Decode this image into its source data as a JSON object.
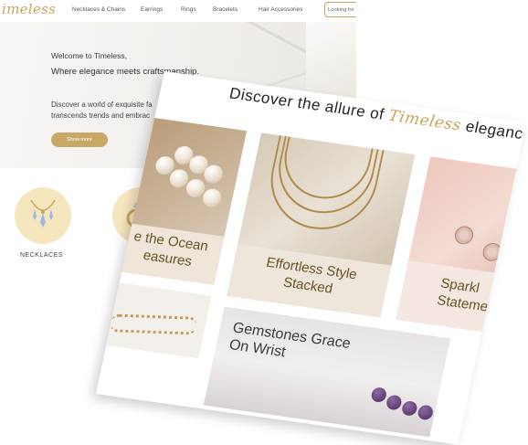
{
  "site": {
    "logo": "Timeless",
    "logo_visible": "imeless",
    "nav": [
      "Necklaces & Chains",
      "Earrings",
      "Rings",
      "Bracelets",
      "Hair Accessories"
    ],
    "search_placeholder": "Looking for"
  },
  "hero": {
    "welcome": "Welcome to Timeless,",
    "tagline": "Where elegance meets craftsmanship.",
    "description": [
      "Discover a world of exquisite fa",
      "transcends trends and embrac"
    ],
    "button_label": "Show more"
  },
  "categories": [
    {
      "label": "NECKLACES",
      "icon": "necklace-icon"
    },
    {
      "label": "",
      "icon": "ring-icon"
    }
  ],
  "feature": {
    "title_before": "Discover the allure of",
    "title_brand": "Timeless",
    "title_after": "elegance",
    "cards": [
      {
        "label": "e the Ocean\neasures",
        "icon": "pearl-necklace-photo"
      },
      {
        "label": "Effortless Style\nStacked",
        "icon": "layered-chain-photo"
      },
      {
        "label": "Sparkl\nStateme",
        "icon": "rose-earrings-photo"
      },
      {
        "label": "",
        "icon": "gold-bracelet-photo"
      },
      {
        "label": "Gemstones Grace\nOn Wrist",
        "icon": "amethyst-bracelet-photo"
      }
    ]
  },
  "colors": {
    "accent": "#c8a45c",
    "button": "#c9a865",
    "category_circle": "#f6e6be",
    "card_text": "#6b5424"
  }
}
